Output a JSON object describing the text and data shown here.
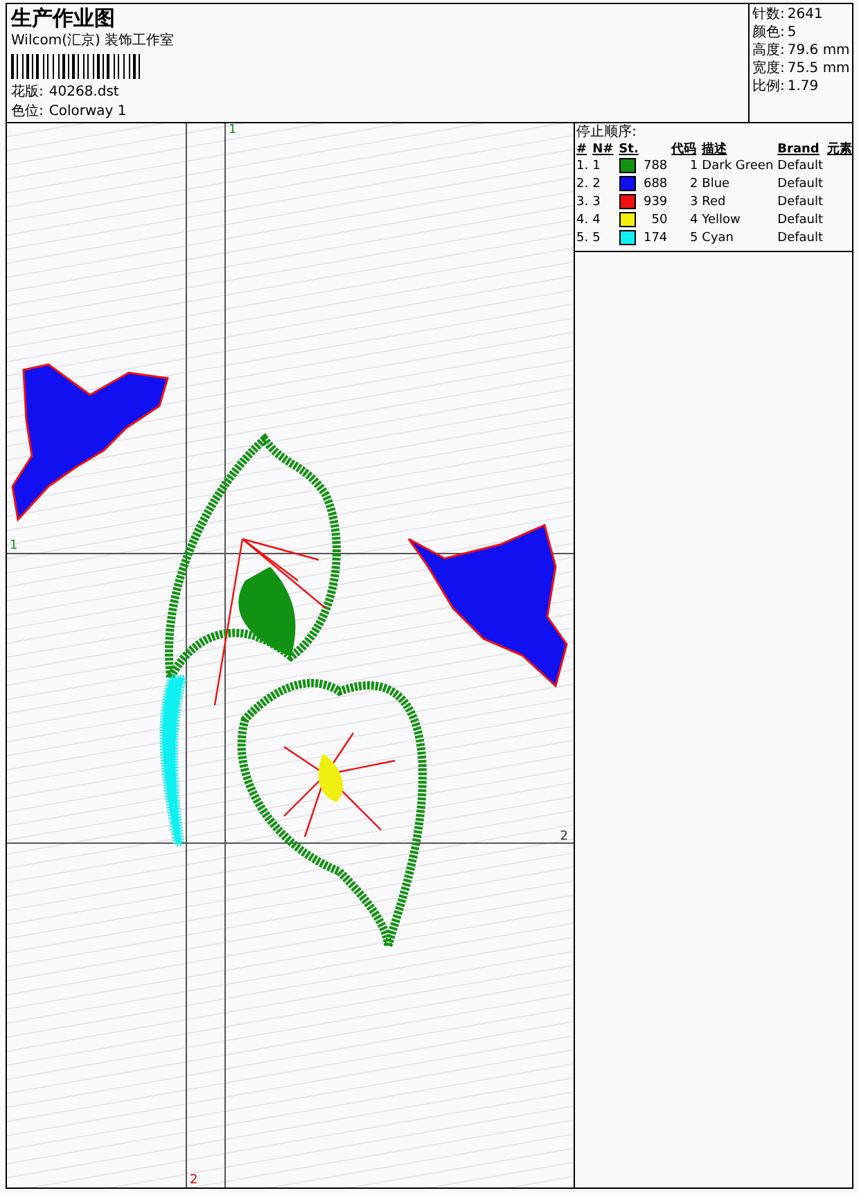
{
  "header": {
    "title": "生产作业图",
    "company": "Wilcom(汇京) 装饰工作室",
    "fields": [
      {
        "label": "花版:",
        "value": "40268.dst"
      },
      {
        "label": "色位:",
        "value": "Colorway 1"
      }
    ]
  },
  "stats": [
    {
      "label": "针数:",
      "value": "2641"
    },
    {
      "label": "颜色:",
      "value": "5"
    },
    {
      "label": "高度:",
      "value": "79.6 mm"
    },
    {
      "label": "宽度:",
      "value": "75.5 mm"
    },
    {
      "label": "比例:",
      "value": "1.79"
    }
  ],
  "canvas": {
    "guide_labels": [
      {
        "text": "1",
        "kind": "top"
      },
      {
        "text": "1",
        "kind": "left"
      },
      {
        "text": "2",
        "kind": "right"
      },
      {
        "text": "2",
        "kind": "bottom"
      }
    ]
  },
  "stop_sequence": {
    "title": "停止顺序:",
    "columns": [
      "#",
      "N#",
      "St.",
      "代码",
      "描述",
      "Brand",
      "元素"
    ],
    "rows": [
      {
        "index": "1.",
        "n": "1",
        "color": "#129212",
        "stitches": "788",
        "code": "1",
        "description": "Dark Green",
        "brand": "Default"
      },
      {
        "index": "2.",
        "n": "2",
        "color": "#1010f0",
        "stitches": "688",
        "code": "2",
        "description": "Blue",
        "brand": "Default"
      },
      {
        "index": "3.",
        "n": "3",
        "color": "#f01010",
        "stitches": "939",
        "code": "3",
        "description": "Red",
        "brand": "Default"
      },
      {
        "index": "4.",
        "n": "4",
        "color": "#f0f010",
        "stitches": "50",
        "code": "4",
        "description": "Yellow",
        "brand": "Default"
      },
      {
        "index": "5.",
        "n": "5",
        "color": "#10f0f0",
        "stitches": "174",
        "code": "5",
        "description": "Cyan",
        "brand": "Default"
      }
    ]
  }
}
